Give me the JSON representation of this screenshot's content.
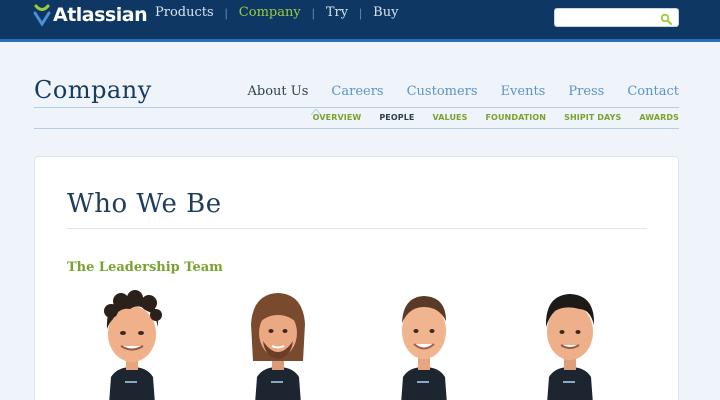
{
  "brand": {
    "name": "Atlassian",
    "logo_icon": "atlassian-logo-icon"
  },
  "top_nav": [
    {
      "label": "Products",
      "active": false
    },
    {
      "label": "Company",
      "active": true
    },
    {
      "label": "Try",
      "active": false
    },
    {
      "label": "Buy",
      "active": false
    }
  ],
  "search": {
    "value": "",
    "placeholder": "",
    "icon": "search-icon"
  },
  "section": {
    "title": "Company"
  },
  "section_nav": [
    {
      "label": "About Us",
      "active": true
    },
    {
      "label": "Careers",
      "active": false
    },
    {
      "label": "Customers",
      "active": false
    },
    {
      "label": "Events",
      "active": false
    },
    {
      "label": "Press",
      "active": false
    },
    {
      "label": "Contact",
      "active": false
    }
  ],
  "sub_nav": [
    {
      "label": "OVERVIEW",
      "active": false
    },
    {
      "label": "PEOPLE",
      "active": true
    },
    {
      "label": "VALUES",
      "active": false
    },
    {
      "label": "FOUNDATION",
      "active": false
    },
    {
      "label": "SHIPIT DAYS",
      "active": false
    },
    {
      "label": "AWARDS",
      "active": false
    }
  ],
  "main": {
    "heading": "Who We Be",
    "subheading": "The Leadership Team"
  },
  "colors": {
    "top_bar": "#0f3764",
    "accent_green": "#9ccc3c",
    "link_blue": "#5d93c4",
    "heading_navy": "#1e3c5c"
  }
}
